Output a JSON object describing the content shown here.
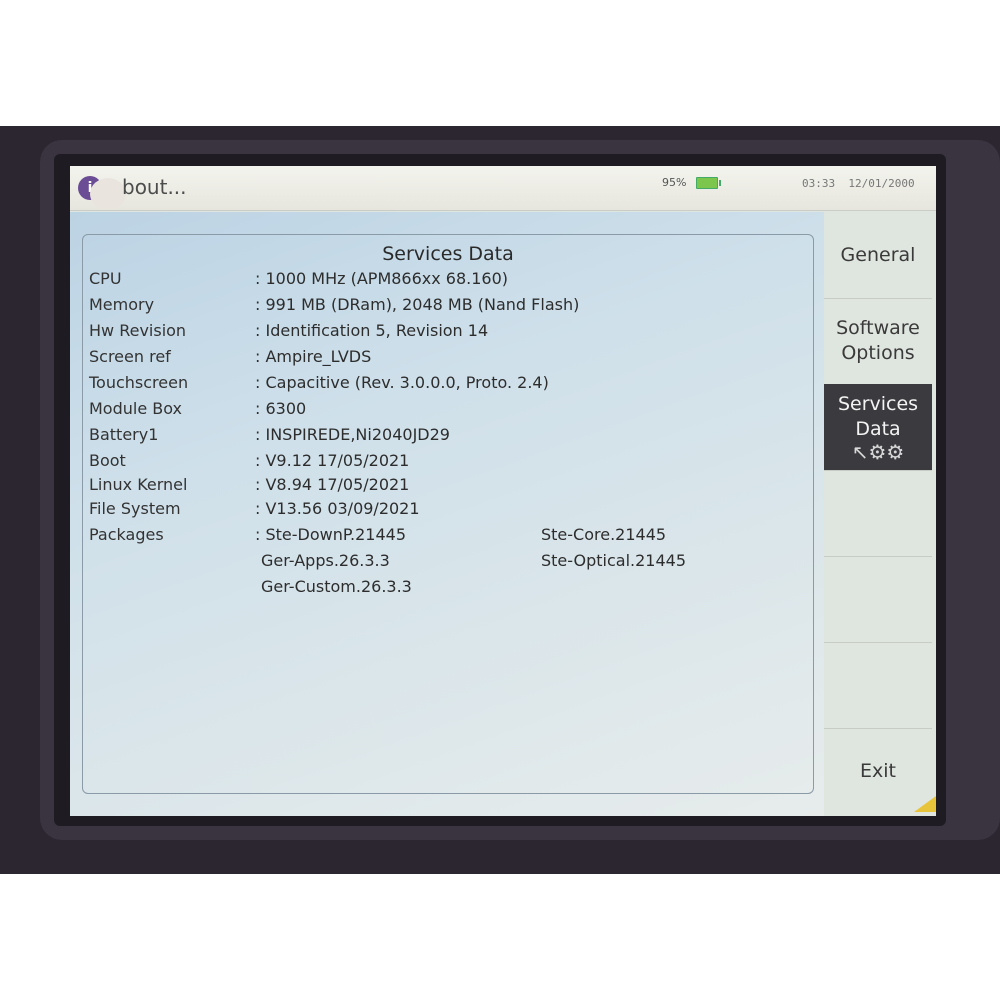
{
  "titlebar": {
    "icon_glyph": "i",
    "title": "bout...",
    "battery_percent": "95%",
    "time": "03:33",
    "date": "12/01/2000"
  },
  "panel": {
    "title": "Services Data",
    "rows": [
      {
        "label": "CPU",
        "value": ": 1000 MHz (APM866xx 68.160)"
      },
      {
        "label": "Memory",
        "value": ": 991 MB (DRam), 2048 MB (Nand Flash)"
      },
      {
        "label": "Hw Revision",
        "value": ": Identification 5, Revision 14"
      },
      {
        "label": "Screen ref",
        "value": ": Ampire_LVDS"
      },
      {
        "label": "Touchscreen",
        "value": ": Capacitive  (Rev. 3.0.0.0, Proto. 2.4)"
      },
      {
        "label": "Module Box",
        "value": ": 6300"
      },
      {
        "label": "Battery1",
        "value": ": INSPIREDE,Ni2040JD29"
      },
      {
        "label": "Boot",
        "value": ": V9.12    17/05/2021"
      },
      {
        "label": "Linux Kernel",
        "value": ": V8.94    17/05/2021"
      },
      {
        "label": "File System",
        "value": ": V13.56  03/09/2021"
      },
      {
        "label": "Packages",
        "value": ": Ste-DownP.21445"
      }
    ],
    "packages_extra": [
      "Ste-Core.21445",
      "Ger-Apps.26.3.3",
      "Ste-Optical.21445",
      "Ger-Custom.26.3.3"
    ]
  },
  "sidebar": {
    "general": "General",
    "software_options_line1": "Software",
    "software_options_line2": "Options",
    "services_data_line1": "Services",
    "services_data_line2": "Data",
    "exit": "Exit"
  },
  "colors": {
    "active_tab": "#3b3a3f",
    "panel_gradient_top": "#bcd3e4",
    "battery_green": "#7cc64e"
  }
}
